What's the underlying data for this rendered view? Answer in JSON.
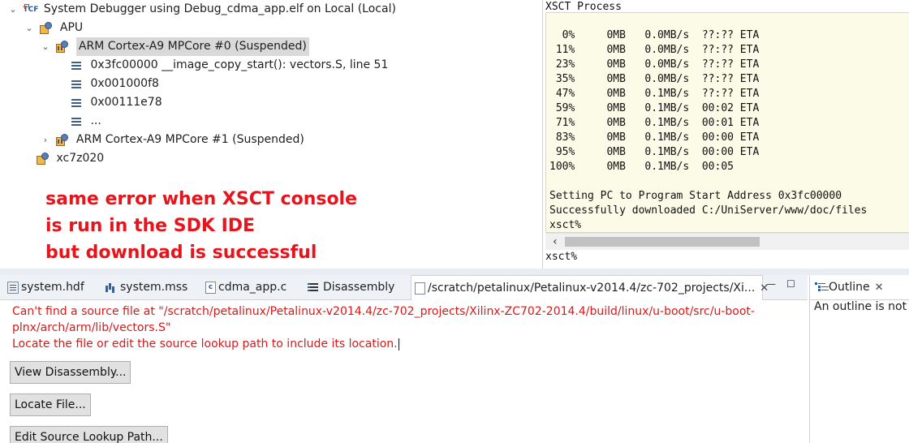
{
  "debug_tree": {
    "root": {
      "label": "System Debugger using Debug_cdma_app.elf on Local (Local)"
    },
    "apu": {
      "label": "APU"
    },
    "core0": {
      "label": "ARM Cortex-A9 MPCore #0 (Suspended)"
    },
    "frames": [
      {
        "label": "0x3fc00000 __image_copy_start(): vectors.S, line 51"
      },
      {
        "label": "0x001000f8"
      },
      {
        "label": "0x00111e78"
      },
      {
        "label": "..."
      }
    ],
    "core1": {
      "label": "ARM Cortex-A9 MPCore #1 (Suspended)"
    },
    "device": {
      "label": "xc7z020"
    }
  },
  "annotation": {
    "lines": [
      "same error when XSCT console",
      "is run in the SDK IDE",
      "but download is successful"
    ]
  },
  "xsct": {
    "title": "XSCT Process",
    "progress_lines": [
      "  0%     0MB   0.0MB/s  ??:?? ETA",
      " 11%     0MB   0.0MB/s  ??:?? ETA",
      " 23%     0MB   0.0MB/s  ??:?? ETA",
      " 35%     0MB   0.0MB/s  ??:?? ETA",
      " 47%     0MB   0.1MB/s  ??:?? ETA",
      " 59%     0MB   0.1MB/s  00:02 ETA",
      " 71%     0MB   0.1MB/s  00:01 ETA",
      " 83%     0MB   0.1MB/s  00:00 ETA",
      " 95%     0MB   0.1MB/s  00:00 ETA",
      "100%     0MB   0.1MB/s  00:05"
    ],
    "tail_lines": [
      "Setting PC to Program Start Address 0x3fc00000",
      "Successfully downloaded C:/UniServer/www/doc/files",
      "xsct%"
    ],
    "input_prompt": "xsct%"
  },
  "editor_tabs": [
    {
      "label": "system.hdf",
      "icon": "hdf-file-icon"
    },
    {
      "label": "system.mss",
      "icon": "mss-file-icon"
    },
    {
      "label": "cdma_app.c",
      "icon": "c-file-icon"
    },
    {
      "label": "Disassembly",
      "icon": "disassembly-icon"
    },
    {
      "label": "/scratch/petalinux/Petalinux-v2014.4/zc-702_projects/Xi...",
      "icon": "file-icon",
      "active": true
    }
  ],
  "editor": {
    "error_lines": [
      "Can't find a source file at \"/scratch/petalinux/Petalinux-v2014.4/zc-702_projects/Xilinx-ZC702-2014.4/build/linux/u-boot/src/u-boot-",
      "plnx/arch/arm/lib/vectors.S\"",
      "Locate the file or edit the source lookup path to include its location."
    ],
    "buttons": {
      "view_disassembly": "View Disassembly...",
      "locate_file": "Locate File...",
      "edit_lookup": "Edit Source Lookup Path..."
    }
  },
  "outline": {
    "tab_label": "Outline",
    "message": "An outline is not a"
  }
}
